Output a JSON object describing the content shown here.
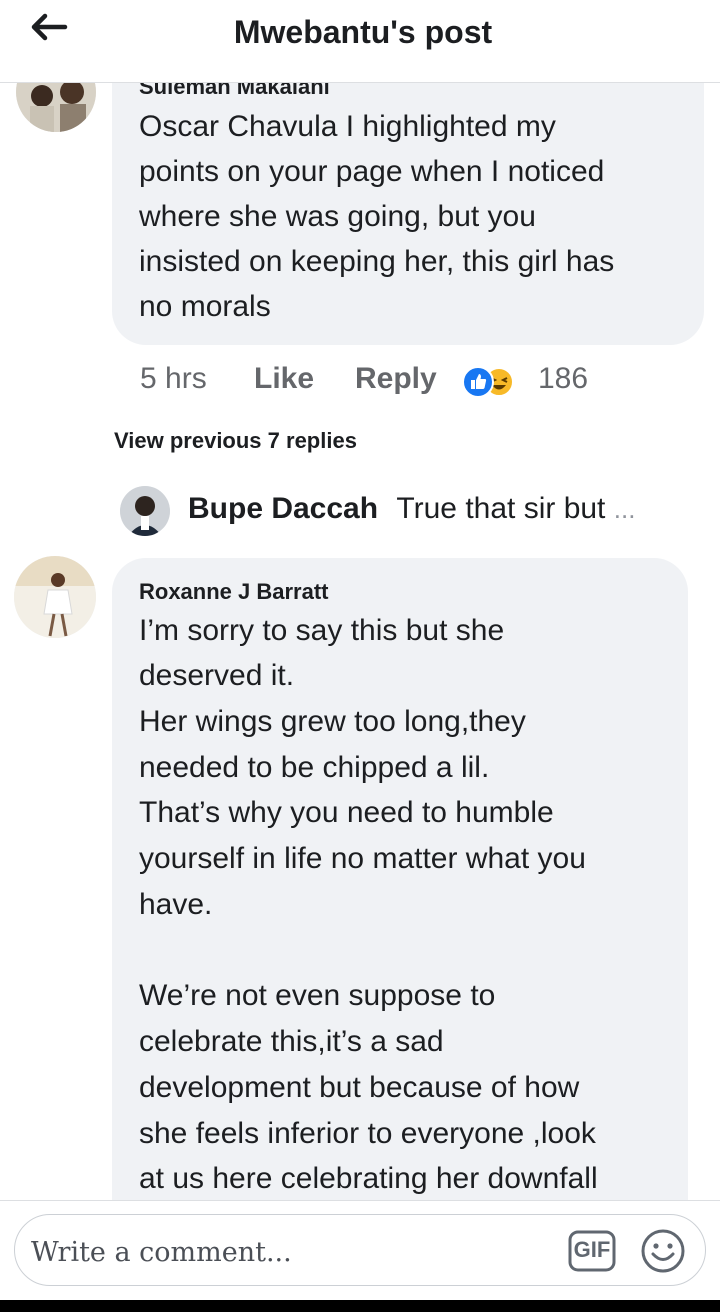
{
  "header": {
    "title": "Mwebantu's post",
    "back_icon": "arrow-left-icon"
  },
  "comments": [
    {
      "author": "Suleman Makalani",
      "text": "Oscar Chavula I highlighted my points on your page when I noticed where she was going, but you insisted on keeping her, this girl has no morals",
      "lines": [
        "Oscar Chavula I highlighted my",
        "points on your page when I noticed",
        "where she was going, but you",
        "insisted on keeping her, this girl has",
        "no morals"
      ],
      "time": "5 hrs",
      "like_label": "Like",
      "reply_label": "Reply",
      "reaction_icons": [
        "like-reaction-icon",
        "haha-reaction-icon"
      ],
      "reaction_count": "186",
      "view_previous": "View previous 7 replies",
      "reply_preview": {
        "name": "Bupe Daccah",
        "text": "True that sir but",
        "ellipsis": "..."
      }
    },
    {
      "author": "Roxanne J Barratt",
      "lines": [
        "I’m sorry to say this but she",
        "deserved it.",
        "Her wings grew too long,they",
        "needed to be chipped a lil.",
        "That’s why you need to humble",
        "yourself in life no matter what you",
        "have.",
        "",
        "We’re not even suppose to",
        "celebrate this,it’s a sad",
        "development but because of how",
        "she feels inferior to everyone ,look",
        "at us here celebrating her downfall"
      ]
    }
  ],
  "composer": {
    "placeholder": "Write a comment...",
    "gif_label": "GIF",
    "emoji_icon": "smiley-icon"
  },
  "colors": {
    "bubble": "#f0f2f5",
    "muted_text": "#65676b",
    "like_blue": "#1877f2",
    "haha_yellow": "#f7b928"
  }
}
